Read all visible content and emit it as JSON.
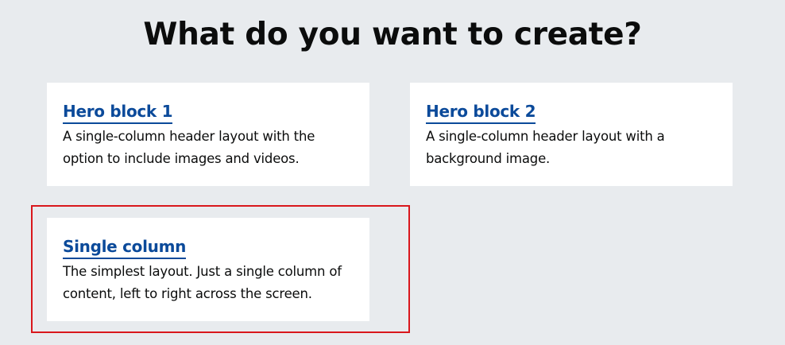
{
  "page": {
    "title": "What do you want to create?"
  },
  "options": [
    {
      "title": "Hero block 1",
      "description": "A single-column header layout with the option to include images and videos."
    },
    {
      "title": "Hero block 2",
      "description": "A single-column header layout with a background image."
    },
    {
      "title": "Single column",
      "description": "The simplest layout. Just a single column of content, left to right across the screen.",
      "highlighted": true
    }
  ],
  "colors": {
    "background": "#e8ebee",
    "card_background": "#ffffff",
    "link": "#0b4a9a",
    "text": "#0b0c0c",
    "highlight_outline": "#d9171c"
  }
}
